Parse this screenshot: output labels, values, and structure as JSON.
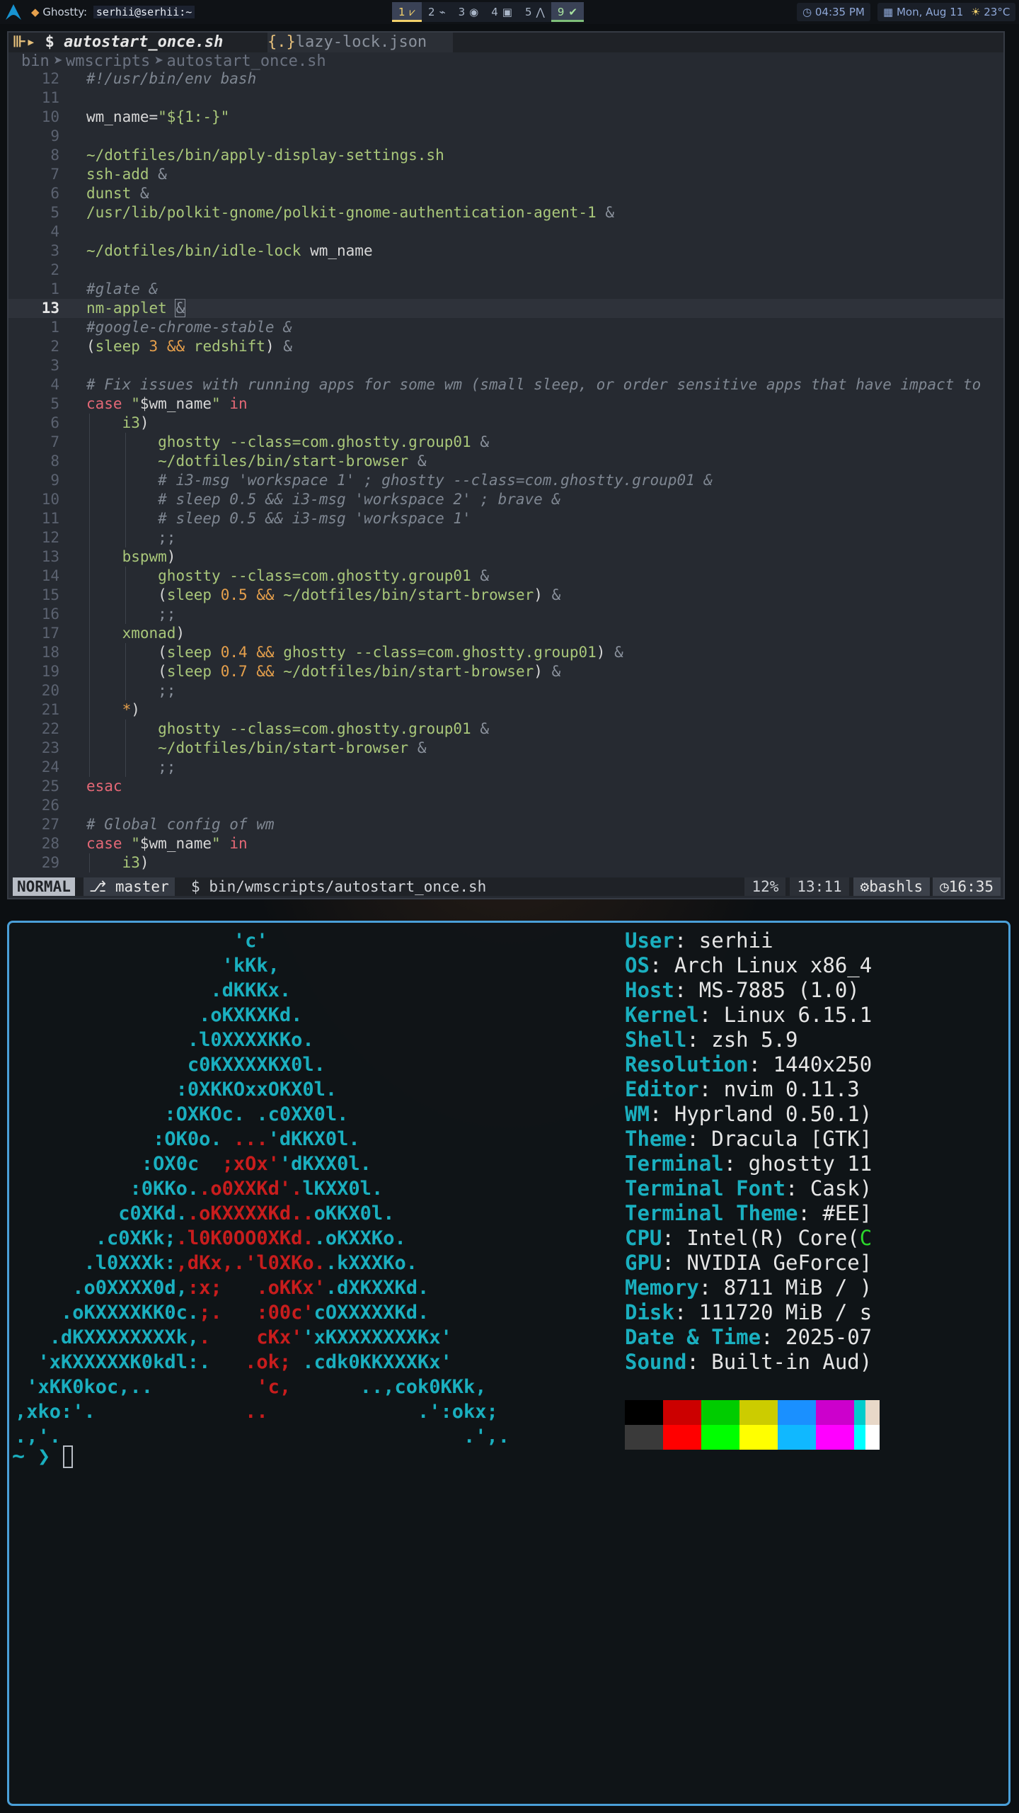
{
  "topbar": {
    "window_app": "Ghostty:",
    "window_path": "serhii@serhii:~",
    "workspaces": [
      {
        "num": "1",
        "icon": "⩗"
      },
      {
        "num": "2",
        "icon": "⌁"
      },
      {
        "num": "3",
        "icon": "◉"
      },
      {
        "num": "4",
        "icon": "▣"
      },
      {
        "num": "5",
        "icon": "⋀"
      },
      {
        "num": "9",
        "icon": "✔"
      }
    ],
    "time": "04:35 PM",
    "date": "Mon, Aug 11",
    "weather": "23°C"
  },
  "editor": {
    "tabs": [
      {
        "label": "autostart_once.sh",
        "prefix": "$"
      },
      {
        "label": "lazy-lock.json",
        "prefix": "{.}"
      }
    ],
    "breadcrumb": [
      "bin",
      "wmscripts",
      "autostart_once.sh"
    ],
    "lines": [
      {
        "n": "12",
        "html": "<span class=\"c\">#!/usr/bin/env bash</span>"
      },
      {
        "n": "11",
        "html": ""
      },
      {
        "n": "10",
        "html": "<span class=\"pl\">wm_name=</span><span class=\"s\">\"${1:-}\"</span>"
      },
      {
        "n": "9",
        "html": ""
      },
      {
        "n": "8",
        "html": "<span class=\"s\">~/dotfiles/bin/apply-display-settings.sh</span>"
      },
      {
        "n": "7",
        "html": "<span class=\"s\">ssh-add</span> <span class=\"dim\">&amp;</span>"
      },
      {
        "n": "6",
        "html": "<span class=\"s\">dunst</span> <span class=\"dim\">&amp;</span>"
      },
      {
        "n": "5",
        "html": "<span class=\"s\">/usr/lib/polkit-gnome/polkit-gnome-authentication-agent-1</span> <span class=\"dim\">&amp;</span>"
      },
      {
        "n": "4",
        "html": ""
      },
      {
        "n": "3",
        "html": "<span class=\"s\">~/dotfiles/bin/idle-lock</span> <span class=\"pl\">wm_name</span>"
      },
      {
        "n": "2",
        "html": ""
      },
      {
        "n": "1",
        "html": "<span class=\"c\">#glate &amp;</span>"
      },
      {
        "n": "13",
        "html": "<span class=\"s\">nm-applet</span> <span class=\"dim\" style=\"outline:1px solid #8a919c\">&amp;</span>",
        "cur": true
      },
      {
        "n": "1",
        "html": "<span class=\"c\">#google-chrome-stable &amp;</span>"
      },
      {
        "n": "2",
        "html": "<span class=\"pl\">(</span><span class=\"s\">sleep</span> <span class=\"num\">3</span> <span class=\"op\">&amp;&amp;</span> <span class=\"s\">redshift</span><span class=\"pl\">)</span> <span class=\"dim\">&amp;</span>"
      },
      {
        "n": "3",
        "html": ""
      },
      {
        "n": "4",
        "html": "<span class=\"c\"># Fix issues with running apps for some wm (small sleep, or order sensitive apps that have impact to</span>"
      },
      {
        "n": "5",
        "html": "<span class=\"kw\">case</span> <span class=\"s\">\"</span><span class=\"pl\">$wm_name</span><span class=\"s\">\"</span> <span class=\"kw\">in</span>"
      },
      {
        "n": "6",
        "html": "    <span class=\"s\">i3</span><span class=\"pl\">)</span>",
        "g": [
          1
        ]
      },
      {
        "n": "7",
        "html": "        <span class=\"s\">ghostty --class=com.ghostty.group01</span> <span class=\"dim\">&amp;</span>",
        "g": [
          1,
          2
        ]
      },
      {
        "n": "8",
        "html": "        <span class=\"s\">~/dotfiles/bin/start-browser</span> <span class=\"dim\">&amp;</span>",
        "g": [
          1,
          2
        ]
      },
      {
        "n": "9",
        "html": "        <span class=\"c\"># i3-msg 'workspace 1' ; ghostty --class=com.ghostty.group01 &amp;</span>",
        "g": [
          1,
          2
        ]
      },
      {
        "n": "10",
        "html": "        <span class=\"c\"># sleep 0.5 &amp;&amp; i3-msg 'workspace 2' ; brave &amp;</span>",
        "g": [
          1,
          2
        ]
      },
      {
        "n": "11",
        "html": "        <span class=\"c\"># sleep 0.5 &amp;&amp; i3-msg 'workspace 1'</span>",
        "g": [
          1,
          2
        ]
      },
      {
        "n": "12",
        "html": "        <span class=\"dim\">;;</span>",
        "g": [
          1,
          2
        ]
      },
      {
        "n": "13",
        "html": "    <span class=\"s\">bspwm</span><span class=\"pl\">)</span>",
        "g": [
          1
        ]
      },
      {
        "n": "14",
        "html": "        <span class=\"s\">ghostty --class=com.ghostty.group01</span> <span class=\"dim\">&amp;</span>",
        "g": [
          1,
          2
        ]
      },
      {
        "n": "15",
        "html": "        <span class=\"pl\">(</span><span class=\"s\">sleep</span> <span class=\"num\">0.5</span> <span class=\"op\">&amp;&amp;</span> <span class=\"s\">~/dotfiles/bin/start-browser</span><span class=\"pl\">)</span> <span class=\"dim\">&amp;</span>",
        "g": [
          1,
          2
        ]
      },
      {
        "n": "16",
        "html": "        <span class=\"dim\">;;</span>",
        "g": [
          1,
          2
        ]
      },
      {
        "n": "17",
        "html": "    <span class=\"s\">xmonad</span><span class=\"pl\">)</span>",
        "g": [
          1
        ]
      },
      {
        "n": "18",
        "html": "        <span class=\"pl\">(</span><span class=\"s\">sleep</span> <span class=\"num\">0.4</span> <span class=\"op\">&amp;&amp;</span> <span class=\"s\">ghostty --class=com.ghostty.group01</span><span class=\"pl\">)</span> <span class=\"dim\">&amp;</span>",
        "g": [
          1,
          2
        ]
      },
      {
        "n": "19",
        "html": "        <span class=\"pl\">(</span><span class=\"s\">sleep</span> <span class=\"num\">0.7</span> <span class=\"op\">&amp;&amp;</span> <span class=\"s\">~/dotfiles/bin/start-browser</span><span class=\"pl\">)</span> <span class=\"dim\">&amp;</span>",
        "g": [
          1,
          2
        ]
      },
      {
        "n": "20",
        "html": "        <span class=\"dim\">;;</span>",
        "g": [
          1,
          2
        ]
      },
      {
        "n": "21",
        "html": "    <span class=\"op\">*</span><span class=\"pl\">)</span>",
        "g": [
          1
        ]
      },
      {
        "n": "22",
        "html": "        <span class=\"s\">ghostty --class=com.ghostty.group01</span> <span class=\"dim\">&amp;</span>",
        "g": [
          1,
          2
        ]
      },
      {
        "n": "23",
        "html": "        <span class=\"s\">~/dotfiles/bin/start-browser</span> <span class=\"dim\">&amp;</span>",
        "g": [
          1,
          2
        ]
      },
      {
        "n": "24",
        "html": "        <span class=\"dim\">;;</span>",
        "g": [
          1,
          2
        ]
      },
      {
        "n": "25",
        "html": "<span class=\"kw\">esac</span>"
      },
      {
        "n": "26",
        "html": ""
      },
      {
        "n": "27",
        "html": "<span class=\"c\"># Global config of wm</span>"
      },
      {
        "n": "28",
        "html": "<span class=\"kw\">case</span> <span class=\"s\">\"</span><span class=\"pl\">$wm_name</span><span class=\"s\">\"</span> <span class=\"kw\">in</span>"
      },
      {
        "n": "29",
        "html": "    <span class=\"s\">i3</span><span class=\"pl\">)</span>",
        "g": [
          1
        ]
      }
    ],
    "status": {
      "mode": "NORMAL",
      "branch": "master",
      "file": "bin/wmscripts/autostart_once.sh",
      "percent": "12%",
      "position": "13:11",
      "lsp": "bashls",
      "clock": "16:35"
    }
  },
  "fastfetch": {
    "logo": [
      {
        "html": "                   'c'"
      },
      {
        "html": "                  'kKk,"
      },
      {
        "html": "                 .dKKKx."
      },
      {
        "html": "                .oKXKXKd."
      },
      {
        "html": "               .l0XXXXKKo."
      },
      {
        "html": "               c0KXXXXKX0l."
      },
      {
        "html": "              :0XKKOxxOKX0l."
      },
      {
        "html": "             :OXKOc. .c0XX0l."
      },
      {
        "html": "            :OK0o. <span class=\"r\">...</span>'dKKX0l."
      },
      {
        "html": "           :OX0c  <span class=\"r\">;xOx'</span>'dKXX0l."
      },
      {
        "html": "          :0KKo.<span class=\"r\">.o0XXKd'.</span>lKXX0l."
      },
      {
        "html": "         c0XKd.<span class=\"r\">.oKXXXXKd..</span>oKKX0l."
      },
      {
        "html": "       .c0XKk;<span class=\"r\">.l0K0OO0XKd.</span>.oKXXKo."
      },
      {
        "html": "      .l0XXXk:<span class=\"r\">,dKx,.'l0XKo.</span>.kXXXKo."
      },
      {
        "html": "     .o0XXXX0d,<span class=\"r\">:x;   .oKKx'</span>.dXKXXKd."
      },
      {
        "html": "    .oKXXXXKK0c.<span class=\"r\">;.   :00c'</span>cOXXXXXKd."
      },
      {
        "html": "   .dKXXXXXXXXk,<span class=\"r\">.    cKx'</span>'xKXXXXXXXKx'"
      },
      {
        "html": "  'xKXXXXXK0kdl:.   <span class=\"r\">.ok;</span> .cdk0KKXXXKx'"
      },
      {
        "html": " 'xKK0koc,..         <span class=\"r\">'c,</span>      ..,cok0KKk,"
      },
      {
        "html": ",xko:'.             <span class=\"r\">..</span>             .':okx;"
      },
      {
        "html": ".,'.                                   .',."
      }
    ],
    "info": [
      {
        "key": "User",
        "val": "serhii"
      },
      {
        "key": "OS",
        "val": "Arch Linux x86_4"
      },
      {
        "key": "Host",
        "val": "MS-7885 (1.0)"
      },
      {
        "key": "Kernel",
        "val": "Linux 6.15.1"
      },
      {
        "key": "Shell",
        "val": "zsh 5.9"
      },
      {
        "key": "Resolution",
        "val": "1440x250"
      },
      {
        "key": "Editor",
        "val": "nvim 0.11.3"
      },
      {
        "key": "WM",
        "val": "Hyprland 0.50.1)"
      },
      {
        "key": "Theme",
        "val": "Dracula [GTK]"
      },
      {
        "key": "Terminal",
        "val": "ghostty 11"
      },
      {
        "key": "Terminal Font",
        "val": "Cask)"
      },
      {
        "key": "Terminal Theme",
        "val": "#EE]"
      },
      {
        "key": "CPU",
        "val": "Intel(R) Core(",
        "tail": "C"
      },
      {
        "key": "GPU",
        "val": "NVIDIA GeForce]"
      },
      {
        "key": "Memory",
        "val": "8711 MiB / )"
      },
      {
        "key": "Disk",
        "val": "111720 MiB / s"
      },
      {
        "key": "Date & Time",
        "val": "2025-07"
      },
      {
        "key": "Sound",
        "val": "Built-in Aud)"
      }
    ],
    "palette_row1": [
      "#000000",
      "#cc0000",
      "#00cc00",
      "#cccc00",
      "#1a90ff",
      "#cc00cc",
      "#00cccc",
      "#e8d8c8"
    ],
    "palette_row2": [
      "#3a3a3a",
      "#ff0000",
      "#00ff00",
      "#ffff00",
      "#10b8ff",
      "#ff00ff",
      "#00ffff",
      "#ffffff"
    ],
    "prompt": "~ ❯"
  }
}
